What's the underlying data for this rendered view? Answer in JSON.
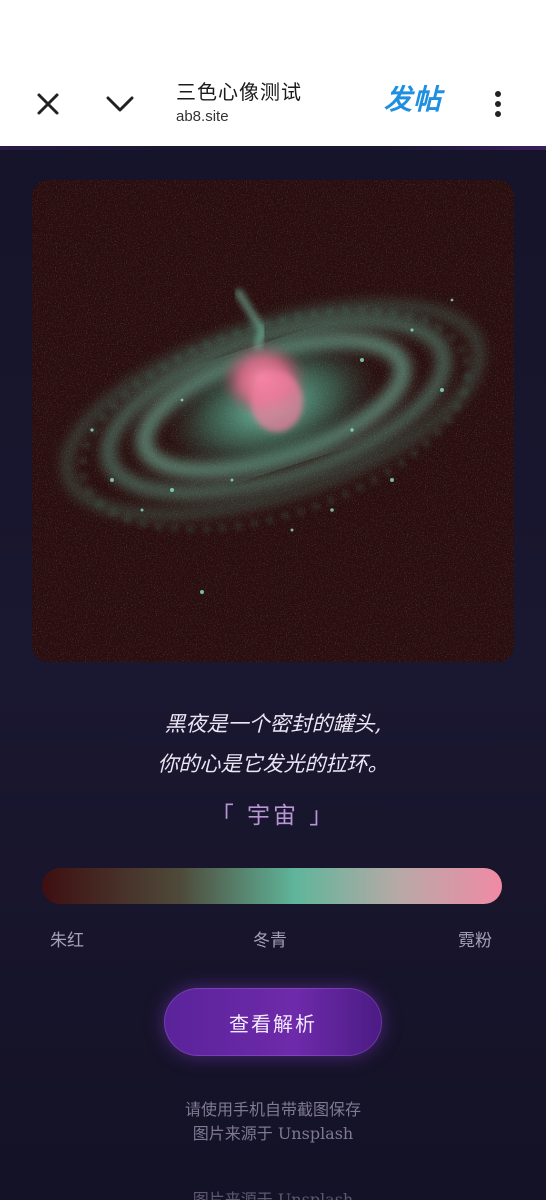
{
  "browser": {
    "title": "三色心像测试",
    "domain": "ab8.site",
    "post_label": "发帖",
    "close_icon": "close-icon",
    "collapse_icon": "chevron-down-icon",
    "more_icon": "more-vertical-icon"
  },
  "result": {
    "image_icon": "galaxy-image",
    "quote_line1": "黑夜是一个密封的罐头,",
    "quote_line2": "你的心是它发光的拉环。",
    "tag": "「 宇宙 」",
    "colors": {
      "left": "#3e0f10",
      "middle": "#5fb59a",
      "right": "#f08aa5"
    },
    "bar_labels": {
      "left": "朱红",
      "middle": "冬青",
      "right": "霓粉"
    },
    "cta_label": "查看解析",
    "save_hint": "请使用手机自带截图保存",
    "credit": "图片来源于 Unsplash",
    "credit_cut": "图片来源于 Unsplash"
  }
}
